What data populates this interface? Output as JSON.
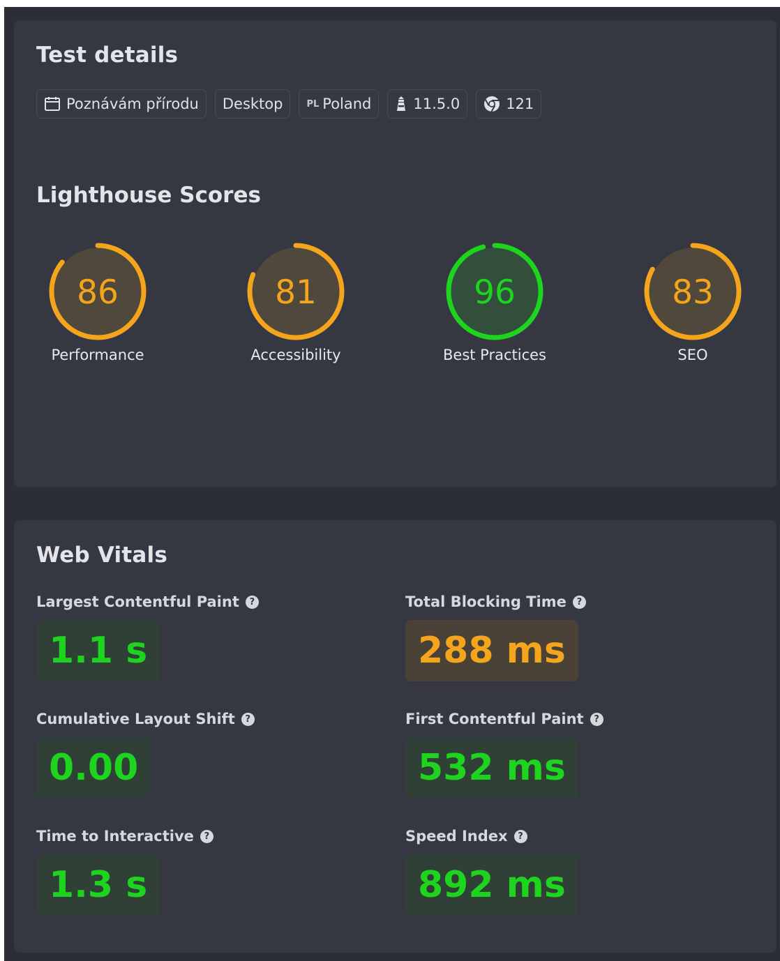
{
  "test_details": {
    "title": "Test details",
    "chips": [
      {
        "icon": "calendar-icon",
        "label": "Poznávám přírodu"
      },
      {
        "icon": "",
        "label": "Desktop"
      },
      {
        "icon": "flag-text",
        "flag": "PL",
        "label": "Poland"
      },
      {
        "icon": "lighthouse-icon",
        "label": "11.5.0"
      },
      {
        "icon": "chrome-icon",
        "label": "121"
      }
    ]
  },
  "lighthouse": {
    "title": "Lighthouse Scores",
    "scores": [
      {
        "label": "Performance",
        "value": "86",
        "fraction": 0.86,
        "color": "#f4a51c"
      },
      {
        "label": "Accessibility",
        "value": "81",
        "fraction": 0.81,
        "color": "#f4a51c"
      },
      {
        "label": "Best Practices",
        "value": "96",
        "fraction": 0.96,
        "color": "#1ed41e"
      },
      {
        "label": "SEO",
        "value": "83",
        "fraction": 0.83,
        "color": "#f4a51c"
      }
    ]
  },
  "web_vitals": {
    "title": "Web Vitals",
    "metrics": [
      {
        "label": "Largest Contentful Paint",
        "value": "1.1 s",
        "status": "good"
      },
      {
        "label": "Total Blocking Time",
        "value": "288 ms",
        "status": "avg"
      },
      {
        "label": "Cumulative Layout Shift",
        "value": "0.00",
        "status": "good"
      },
      {
        "label": "First Contentful Paint",
        "value": "532 ms",
        "status": "good"
      },
      {
        "label": "Time to Interactive",
        "value": "1.3 s",
        "status": "good"
      },
      {
        "label": "Speed Index",
        "value": "892 ms",
        "status": "good"
      }
    ]
  },
  "colors": {
    "good": "#1ed41e",
    "average": "#f4a51c",
    "card_bg": "#353842"
  }
}
